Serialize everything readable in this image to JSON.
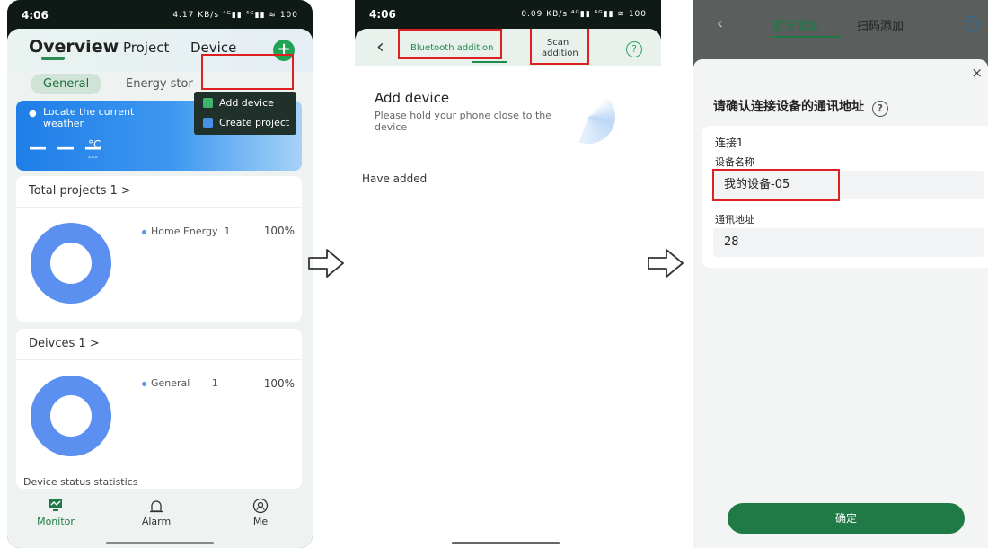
{
  "colors": {
    "brand_green": "#1f7a45",
    "highlight_red": "#e02020",
    "donut_blue": "#5b8ff0",
    "weather_blue": "#1f7ee8"
  },
  "screen1": {
    "status": {
      "time": "4:06",
      "indicators": "4.17 KB/s ⁴ᴳ▮▮ ⁴ᴳ▮▮ ≋ 100"
    },
    "tabs": [
      "Overview",
      "Project",
      "Device"
    ],
    "add_icon": "plus-icon",
    "subtabs": {
      "active": "General",
      "other": "Energy stor"
    },
    "dropdown": {
      "add_device": "Add device",
      "create_project": "Create project"
    },
    "weather": {
      "location_text": "Locate the current weather",
      "temp": "— — —",
      "unit": "°C",
      "sub": "---",
      "corner": "----"
    },
    "projects_card": {
      "title": "Total projects 1 >",
      "legend_label": "Home Energy",
      "legend_count": "1",
      "percent": "100%"
    },
    "devices_card": {
      "title": "Deivces 1 >",
      "legend_label": "General",
      "legend_count": "1",
      "percent": "100%"
    },
    "stats_label": "Device status statistics",
    "nav": [
      {
        "label": "Monitor",
        "icon": "monitor-icon"
      },
      {
        "label": "Alarm",
        "icon": "alarm-icon"
      },
      {
        "label": "Me",
        "icon": "profile-icon"
      }
    ]
  },
  "screen2": {
    "status": {
      "time": "4:06",
      "indicators": "0.09 KB/s ⁴ᴳ▮▮ ⁴ᴳ▮▮ ≋ 100"
    },
    "tab_bluetooth": "Bluetooth addition",
    "tab_scan": "Scan addition",
    "help": "?",
    "title": "Add device",
    "subtitle": "Please hold your phone close to the device",
    "have_added": "Have added"
  },
  "screen3": {
    "tab_bluetooth": "蓝牙添加",
    "tab_scan": "扫码添加",
    "help": "?",
    "close": "×",
    "heading": "请确认连接设备的通讯地址",
    "connection_label": "连接1",
    "device_name_label": "设备名称",
    "device_name_value": "我的设备-05",
    "address_label": "通讯地址",
    "address_value": "28",
    "confirm": "确定"
  }
}
